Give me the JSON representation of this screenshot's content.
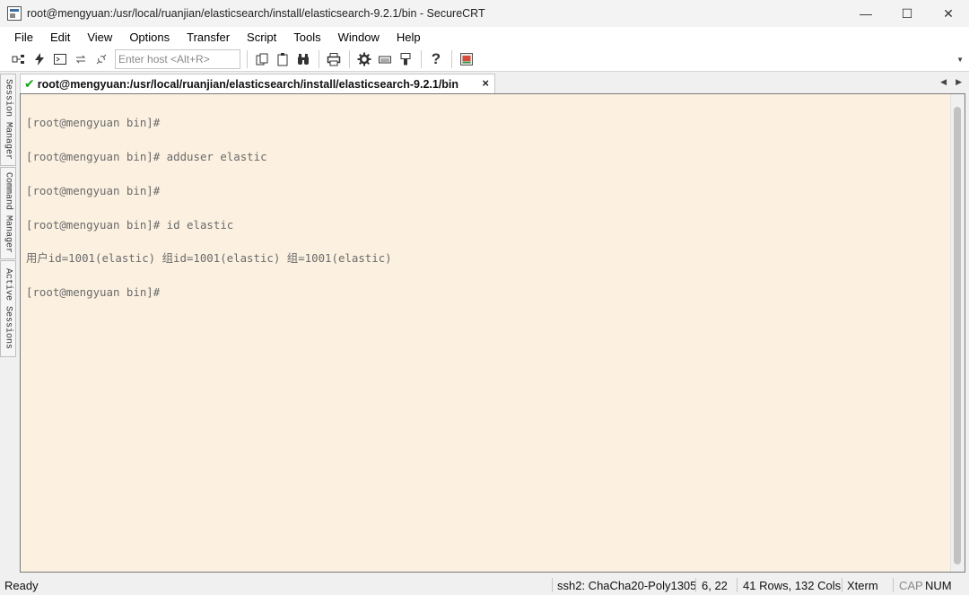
{
  "window": {
    "title": "root@mengyuan:/usr/local/ruanjian/elasticsearch/install/elasticsearch-9.2.1/bin - SecureCRT",
    "controls": {
      "minimize": "—",
      "maximize": "☐",
      "close": "✕"
    }
  },
  "menu": [
    "File",
    "Edit",
    "View",
    "Options",
    "Transfer",
    "Script",
    "Tools",
    "Window",
    "Help"
  ],
  "toolbar": {
    "host_placeholder": "Enter host <Alt+R>",
    "icons": [
      "connect-icon",
      "quick-connect-icon",
      "connect-tab-icon",
      "reconnect-icon",
      "disconnect-icon",
      "copy-icon",
      "paste-icon",
      "find-icon",
      "print-icon",
      "settings-icon",
      "keymap-icon",
      "sftp-icon",
      "help-icon",
      "screen-icon"
    ]
  },
  "side_panel": {
    "tabs": [
      "Session Manager",
      "Command Manager",
      "Active Sessions"
    ]
  },
  "session_tab": {
    "label": "root@mengyuan:/usr/local/ruanjian/elasticsearch/install/elasticsearch-9.2.1/bin",
    "close": "×",
    "status_icon": "check-icon"
  },
  "terminal": {
    "lines": [
      "[root@mengyuan bin]#",
      "[root@mengyuan bin]# adduser elastic",
      "[root@mengyuan bin]#",
      "[root@mengyuan bin]# id elastic",
      "用户id=1001(elastic) 组id=1001(elastic) 组=1001(elastic)",
      "[root@mengyuan bin]#"
    ],
    "background": "#fcf1e1",
    "text_color": "#6a6a6a"
  },
  "status_bar": {
    "ready": "Ready",
    "protocol": "ssh2: ChaCha20-Poly1305",
    "cursor": "6,  22",
    "size": "41 Rows, 132 Cols",
    "term_type": "Xterm",
    "cap": "CAP",
    "num": "NUM"
  }
}
